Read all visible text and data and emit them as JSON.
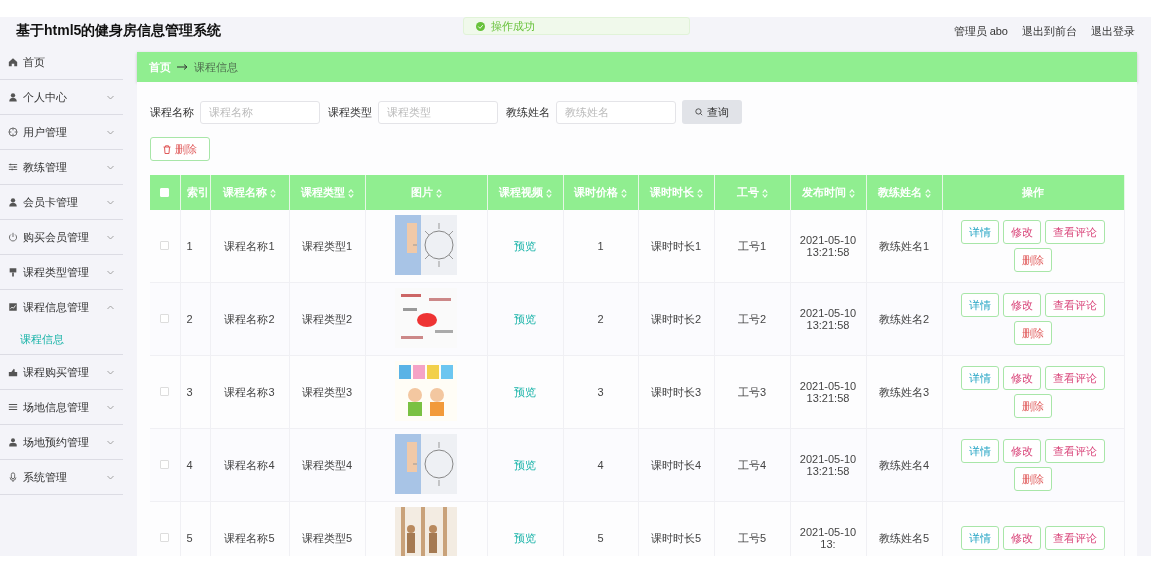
{
  "header": {
    "title": "基于html5的健身房信息管理系统",
    "user": "管理员 abo",
    "links": [
      "退出到前台",
      "退出登录"
    ]
  },
  "toast": {
    "message": "操作成功"
  },
  "sidebar": {
    "items": [
      {
        "label": "首页",
        "kind": "link"
      },
      {
        "label": "个人中心",
        "kind": "menu",
        "expanded": false
      },
      {
        "label": "用户管理",
        "kind": "menu",
        "expanded": false
      },
      {
        "label": "教练管理",
        "kind": "menu",
        "expanded": false
      },
      {
        "label": "会员卡管理",
        "kind": "menu",
        "expanded": false
      },
      {
        "label": "购买会员管理",
        "kind": "menu",
        "expanded": false
      },
      {
        "label": "课程类型管理",
        "kind": "menu",
        "expanded": false
      },
      {
        "label": "课程信息管理",
        "kind": "menu",
        "expanded": true,
        "children": [
          {
            "label": "课程信息",
            "selected": true
          }
        ]
      },
      {
        "label": "课程购买管理",
        "kind": "menu",
        "expanded": false
      },
      {
        "label": "场地信息管理",
        "kind": "menu",
        "expanded": false
      },
      {
        "label": "场地预约管理",
        "kind": "menu",
        "expanded": false
      },
      {
        "label": "系统管理",
        "kind": "menu",
        "expanded": false
      }
    ]
  },
  "breadcrumb": [
    "首页",
    "课程信息"
  ],
  "search": {
    "fields": [
      {
        "label": "课程名称",
        "placeholder": "课程名称"
      },
      {
        "label": "课程类型",
        "placeholder": "课程类型"
      },
      {
        "label": "教练姓名",
        "placeholder": "教练姓名"
      }
    ],
    "button": "查询"
  },
  "delete_button": "删除",
  "table": {
    "select_all": {
      "checked": false
    },
    "columns": [
      {
        "label": "索引",
        "sortable": false
      },
      {
        "label": "课程名称",
        "sortable": true
      },
      {
        "label": "课程类型",
        "sortable": true
      },
      {
        "label": "图片",
        "sortable": true
      },
      {
        "label": "课程视频",
        "sortable": true
      },
      {
        "label": "课时价格",
        "sortable": true
      },
      {
        "label": "课时时长",
        "sortable": true
      },
      {
        "label": "工号",
        "sortable": true
      },
      {
        "label": "发布时间",
        "sortable": true
      },
      {
        "label": "教练姓名",
        "sortable": true
      },
      {
        "label": "操作",
        "sortable": false
      }
    ],
    "rows": [
      {
        "selected": false,
        "cells": [
          "1",
          "课程名称1",
          "课程类型1"
        ],
        "picture": {
          "kind": "picture"
        },
        "video": "预览",
        "rest": [
          "1",
          "课时时长1",
          "工号1",
          "2021-05-10 13:21:58",
          "教练姓名1"
        ],
        "actions": [
          "详情",
          "修改",
          "查看评论",
          "删除"
        ]
      },
      {
        "selected": false,
        "cells": [
          "2",
          "课程名称2",
          "课程类型2"
        ],
        "picture": {
          "kind": "picture"
        },
        "video": "预览",
        "rest": [
          "2",
          "课时时长2",
          "工号2",
          "2021-05-10 13:21:58",
          "教练姓名2"
        ],
        "actions": [
          "详情",
          "修改",
          "查看评论",
          "删除"
        ]
      },
      {
        "selected": false,
        "cells": [
          "3",
          "课程名称3",
          "课程类型3"
        ],
        "picture": {
          "kind": "picture"
        },
        "video": "预览",
        "rest": [
          "3",
          "课时时长3",
          "工号3",
          "2021-05-10 13:21:58",
          "教练姓名3"
        ],
        "actions": [
          "详情",
          "修改",
          "查看评论",
          "删除"
        ]
      },
      {
        "selected": false,
        "cells": [
          "4",
          "课程名称4",
          "课程类型4"
        ],
        "picture": {
          "kind": "picture"
        },
        "video": "预览",
        "rest": [
          "4",
          "课时时长4",
          "工号4",
          "2021-05-10 13:21:58",
          "教练姓名4"
        ],
        "actions": [
          "详情",
          "修改",
          "查看评论",
          "删除"
        ]
      },
      {
        "selected": false,
        "cells": [
          "5",
          "课程名称5",
          "课程类型5"
        ],
        "picture": {
          "kind": "picture"
        },
        "video": "预览",
        "rest": [
          "5",
          "课时时长5",
          "工号5",
          "2021-05-10 13:",
          "教练姓名5"
        ],
        "actions": [
          "详情",
          "修改",
          "查看评论"
        ]
      }
    ]
  }
}
